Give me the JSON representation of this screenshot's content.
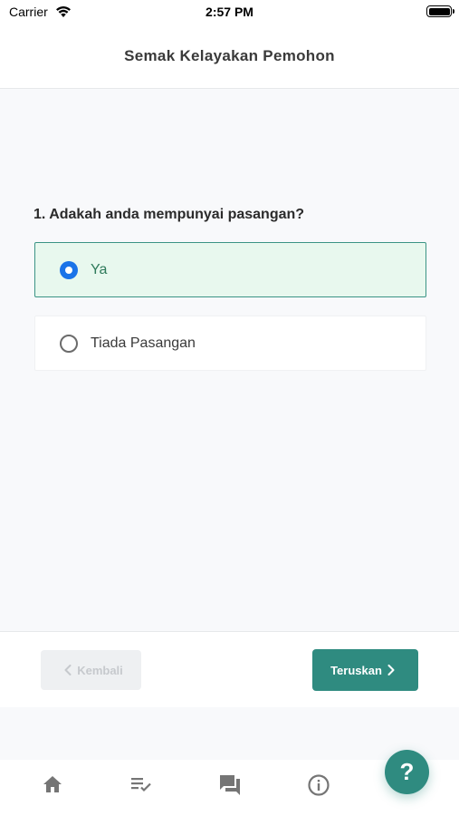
{
  "status_bar": {
    "carrier": "Carrier",
    "time": "2:57 PM"
  },
  "header": {
    "title": "Semak Kelayakan Pemohon"
  },
  "question": {
    "text": "1. Adakah anda mempunyai pasangan?",
    "options": [
      {
        "label": "Ya",
        "selected": true
      },
      {
        "label": "Tiada Pasangan",
        "selected": false
      }
    ]
  },
  "footer": {
    "back_label": "Kembali",
    "next_label": "Teruskan"
  },
  "tabbar": {
    "icons": [
      "home-icon",
      "checklist-icon",
      "chat-icon",
      "info-icon"
    ]
  },
  "help": {
    "label": "?"
  },
  "colors": {
    "accent": "#2f8b80",
    "selected_bg": "#e8f8ee",
    "radio": "#1a73e8"
  }
}
